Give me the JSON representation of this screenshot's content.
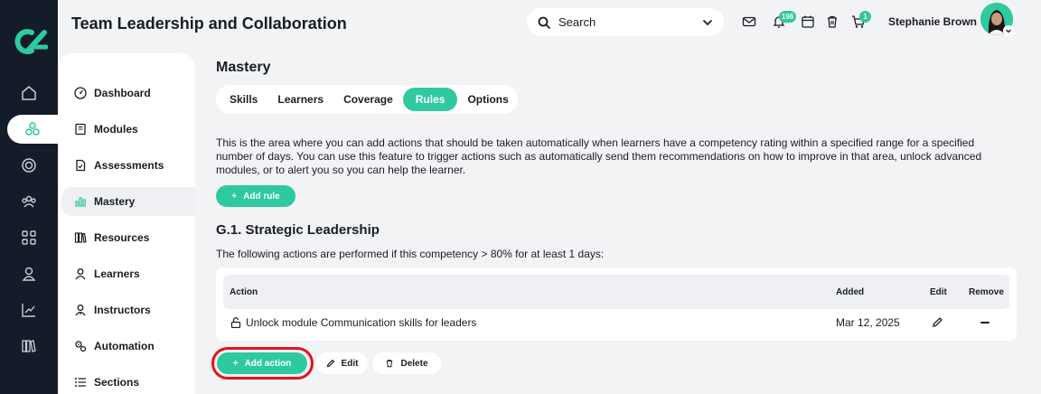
{
  "app": {
    "page_title": "Team Leadership and Collaboration",
    "brand_color": "#2fc9a0",
    "rail_color": "#141b29"
  },
  "header": {
    "search_placeholder": "Search",
    "notifications_count": "196",
    "cart_count": "1",
    "user_name": "Stephanie Brown"
  },
  "rail": {
    "icons": [
      "home-icon",
      "modules-icon",
      "target-icon",
      "people-icon",
      "grid-icon",
      "user-icon",
      "chart-icon",
      "library-icon"
    ],
    "active_index": 1
  },
  "sidebar": {
    "items": [
      {
        "label": "Dashboard",
        "icon": "dashboard-icon"
      },
      {
        "label": "Modules",
        "icon": "book-icon"
      },
      {
        "label": "Assessments",
        "icon": "assessment-icon"
      },
      {
        "label": "Mastery",
        "icon": "bar-chart-icon"
      },
      {
        "label": "Resources",
        "icon": "resources-icon"
      },
      {
        "label": "Learners",
        "icon": "learner-icon"
      },
      {
        "label": "Instructors",
        "icon": "instructor-icon"
      },
      {
        "label": "Automation",
        "icon": "automation-icon"
      },
      {
        "label": "Sections",
        "icon": "list-icon"
      }
    ],
    "active_index": 3
  },
  "main": {
    "section_title": "Mastery",
    "tabs": [
      {
        "label": "Skills"
      },
      {
        "label": "Learners"
      },
      {
        "label": "Coverage"
      },
      {
        "label": "Rules"
      },
      {
        "label": "Options"
      }
    ],
    "active_tab": 3,
    "description": "This is the area where you can add actions that should be taken automatically when learners have a competency rating within a specified range for a specified number of days. You can use this feature to trigger actions such as automatically send them recommendations on how to improve in that area, unlock advanced modules, or to alert you so you can help the learner.",
    "add_rule_label": "Add rule",
    "group_title": "G.1. Strategic Leadership",
    "group_desc": "The following actions are performed if this competency > 80% for at least 1 days:",
    "table": {
      "columns": {
        "action": "Action",
        "added": "Added",
        "edit": "Edit",
        "remove": "Remove"
      },
      "rows": [
        {
          "action": "Unlock module Communication skills for leaders",
          "added": "Mar 12, 2025"
        }
      ]
    },
    "add_action_label": "Add action",
    "edit_label": "Edit",
    "delete_label": "Delete"
  }
}
